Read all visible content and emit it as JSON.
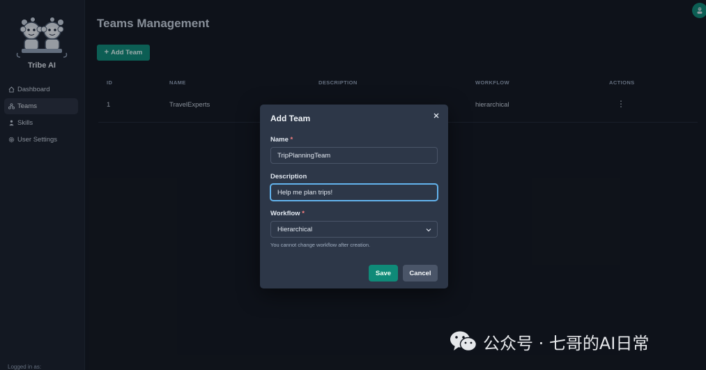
{
  "app": {
    "name": "Tribe AI",
    "brand_color": "#0f8a78"
  },
  "sidebar": {
    "items": [
      {
        "label": "Dashboard",
        "icon": "home-icon",
        "active": false
      },
      {
        "label": "Teams",
        "icon": "teams-icon",
        "active": true
      },
      {
        "label": "Skills",
        "icon": "skills-icon",
        "active": false
      },
      {
        "label": "User Settings",
        "icon": "gear-icon",
        "active": false
      }
    ],
    "logged_in_label": "Logged in as:"
  },
  "header": {
    "title": "Teams Management",
    "add_button_label": "Add Team",
    "add_button_icon": "plus-icon",
    "avatar_icon": "user-avatar-icon"
  },
  "table": {
    "columns": [
      "ID",
      "NAME",
      "DESCRIPTION",
      "WORKFLOW",
      "ACTIONS"
    ],
    "rows": [
      {
        "id": "1",
        "name": "TravelExperts",
        "description": "",
        "workflow": "hierarchical",
        "actions_icon": "kebab-menu-icon"
      }
    ]
  },
  "modal": {
    "title": "Add Team",
    "close_icon": "close-icon",
    "name_label": "Name",
    "name_value": "TripPlanningTeam",
    "description_label": "Description",
    "description_value": "Help me plan trips!",
    "workflow_label": "Workflow",
    "workflow_value": "Hierarchical",
    "required_marker": "*",
    "helper_text": "You cannot change workflow after creation.",
    "save_label": "Save",
    "cancel_label": "Cancel"
  },
  "watermark": {
    "text": "公众号 · 七哥的AI日常",
    "icon": "wechat-icon"
  }
}
